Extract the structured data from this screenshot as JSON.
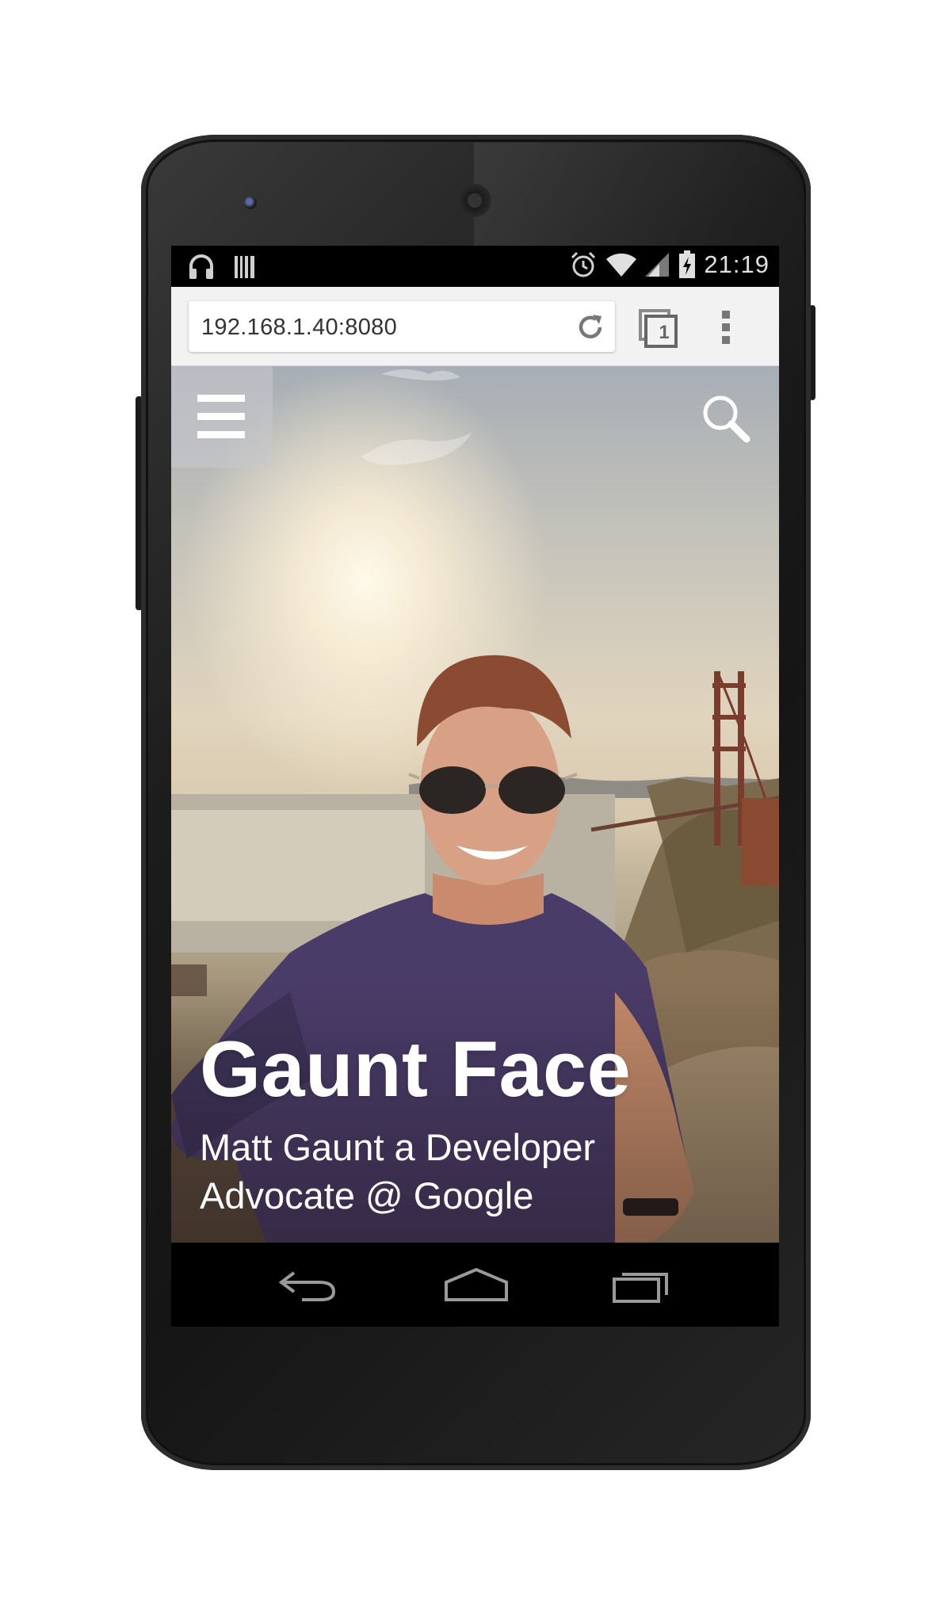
{
  "status_bar": {
    "time": "21:19",
    "left_icons": [
      "headphones-icon",
      "barcode-icon"
    ],
    "right_icons": [
      "alarm-icon",
      "wifi-icon",
      "cell-signal-icon",
      "battery-charging-icon"
    ]
  },
  "browser": {
    "url": "192.168.1.40:8080",
    "tab_count": "1",
    "icons": {
      "reload": "reload-icon",
      "tabs": "tabs-icon",
      "menu": "overflow-menu-icon"
    }
  },
  "page": {
    "title": "Gaunt Face",
    "subtitle": "Matt Gaunt a Developer Advocate @ Google",
    "menu_icon": "hamburger-menu-icon",
    "search_icon": "search-icon",
    "hero_image": "selfie-golden-gate-bridge-photo"
  },
  "nav_bar": {
    "buttons": [
      "back-icon",
      "home-icon",
      "recent-apps-icon"
    ]
  },
  "colors": {
    "toolbar_bg": "#f2f2f2",
    "status_bar_bg": "#000000",
    "overlay_menu_bg": "#c8c8cd",
    "title_text": "#ffffff"
  }
}
